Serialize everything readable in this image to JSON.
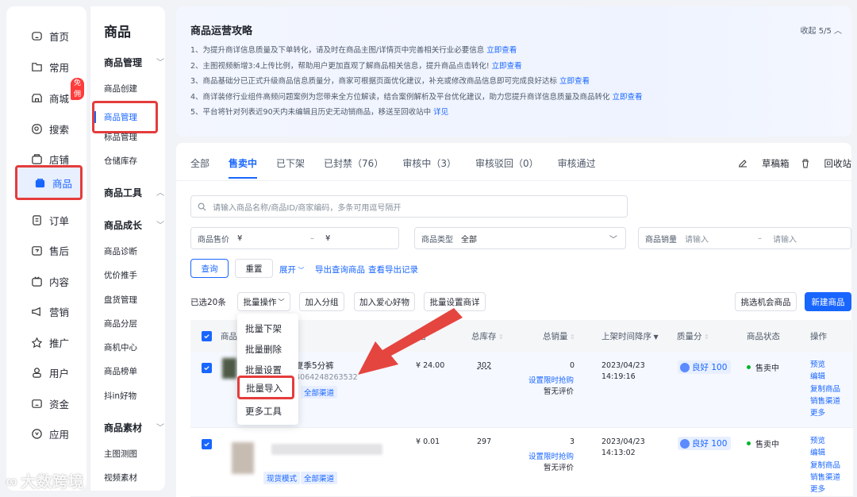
{
  "nav": {
    "items": [
      {
        "label": "首页",
        "icon": "home-icon"
      },
      {
        "label": "常用",
        "icon": "folder-icon"
      },
      {
        "label": "商城",
        "icon": "shop-icon",
        "badge": "免佣"
      },
      {
        "label": "搜索",
        "icon": "search-icon"
      },
      {
        "label": "店铺",
        "icon": "store-icon"
      },
      {
        "label": "商品",
        "icon": "bag-icon",
        "active": true
      },
      {
        "label": "订单",
        "icon": "order-icon"
      },
      {
        "label": "售后",
        "icon": "aftersale-icon"
      },
      {
        "label": "内容",
        "icon": "tv-icon"
      },
      {
        "label": "营销",
        "icon": "megaphone-icon"
      },
      {
        "label": "推广",
        "icon": "promote-icon"
      },
      {
        "label": "用户",
        "icon": "user-icon"
      },
      {
        "label": "资金",
        "icon": "wallet-icon"
      },
      {
        "label": "应用",
        "icon": "app-icon"
      }
    ]
  },
  "subnav": {
    "title": "商品",
    "groups": [
      {
        "label": "商品管理",
        "items": [
          "商品创建",
          "商品管理",
          "标品管理",
          "仓储库存"
        ]
      },
      {
        "label": "商品工具",
        "items": []
      },
      {
        "label": "商品成长",
        "items": [
          "商品诊断",
          "优价推手",
          "盘货管理",
          "商品分层",
          "商机中心",
          "商品榜单",
          "抖in好物"
        ]
      },
      {
        "label": "商品素材",
        "items": [
          "主图测图",
          "视频素材"
        ]
      }
    ]
  },
  "guide": {
    "title": "商品运营攻略",
    "collapse": "收起 5/5",
    "items": [
      {
        "text": "1、为提升商详信息质量及下单转化，请及时在商品主图/详情页中完善相关行业必要信息",
        "link": "立即查看"
      },
      {
        "text": "2、主图视频新增3:4上传比例，帮助用户更加直观了解商品相关信息，提升商品点击转化!",
        "link": "立即查看"
      },
      {
        "text": "3、商品基础分已正式升级商品信息质量分，商家可根据页面优化建议，补充或修改商品信息即可完成良好达标",
        "link": "立即查看"
      },
      {
        "text": "4、商详装修行业组件高频问题案例为您带来全方位解读，结合案例解析及平台优化建议，助力您提升商详信息质量及商品转化",
        "link": "立即查看"
      },
      {
        "text": "5、平台将针对列表近90天内未编辑且历史无动销商品，移送至回收站中",
        "link": "详见"
      }
    ]
  },
  "tabs": [
    "全部",
    "售卖中",
    "已下架",
    "已封禁（76）",
    "审核中（3）",
    "审核驳回（0）",
    "审核通过"
  ],
  "tab_actions": {
    "drafts": "草稿箱",
    "recycle": "回收站"
  },
  "filters": {
    "search_placeholder": "请输入商品名称/商品ID/商家编码，多条可用逗号隔开",
    "price_label": "商品售价",
    "price_from": "¥",
    "price_sep": "–",
    "price_to": "¥",
    "type_label": "商品类型",
    "type_value": "全部",
    "sales_label": "商品销量",
    "sales_from": "请输入",
    "sales_sep": "–",
    "sales_to": "请输入"
  },
  "actions": {
    "query": "查询",
    "reset": "重置",
    "expand": "展开",
    "export": "导出查询商品",
    "export_log": "查看导出记录",
    "selected": "已选20条",
    "batch": "批量操作",
    "add_group": "加入分组",
    "add_love": "加入爱心好物",
    "batch_detail": "批量设置商详",
    "pick": "挑选机会商品",
    "new": "新建商品"
  },
  "dropdown": [
    "批量下架",
    "批量删除",
    "批量设置",
    "批量导入",
    "更多工具"
  ],
  "table": {
    "headers": [
      "商品",
      "价格",
      "总库存",
      "总销量",
      "上架时间降序",
      "质量分",
      "商品状态",
      "操作"
    ],
    "rows": [
      {
        "title": "夏季5分裤",
        "id": "3604064248263532",
        "tags": [
          "全部渠道"
        ],
        "price": "¥ 24.00",
        "stock": "302",
        "sales": "0",
        "flash": "设置限时抢购",
        "review": "暂无评价",
        "date": "2023/04/23",
        "time": "14:19:16",
        "quality": "良好 100",
        "status": "售卖中",
        "ops": [
          "预览",
          "编辑",
          "复制商品",
          "销售渠道",
          "更多"
        ]
      },
      {
        "title": "",
        "id": "",
        "tags": [
          "现货模式",
          "全部渠道"
        ],
        "price": "¥ 0.01",
        "stock": "297",
        "sales": "3",
        "flash": "设置限时抢购",
        "review": "暂无评价",
        "date": "2023/04/23",
        "time": "14:13:02",
        "quality": "良好 100",
        "status": "售卖中",
        "ops": [
          "预览",
          "编辑",
          "复制商品",
          "销售渠道",
          "更多"
        ]
      }
    ]
  },
  "watermark": "大数跨境",
  "colors": {
    "accent": "#1966ff",
    "highlight": "#e53c3c",
    "success": "#00b42a"
  }
}
